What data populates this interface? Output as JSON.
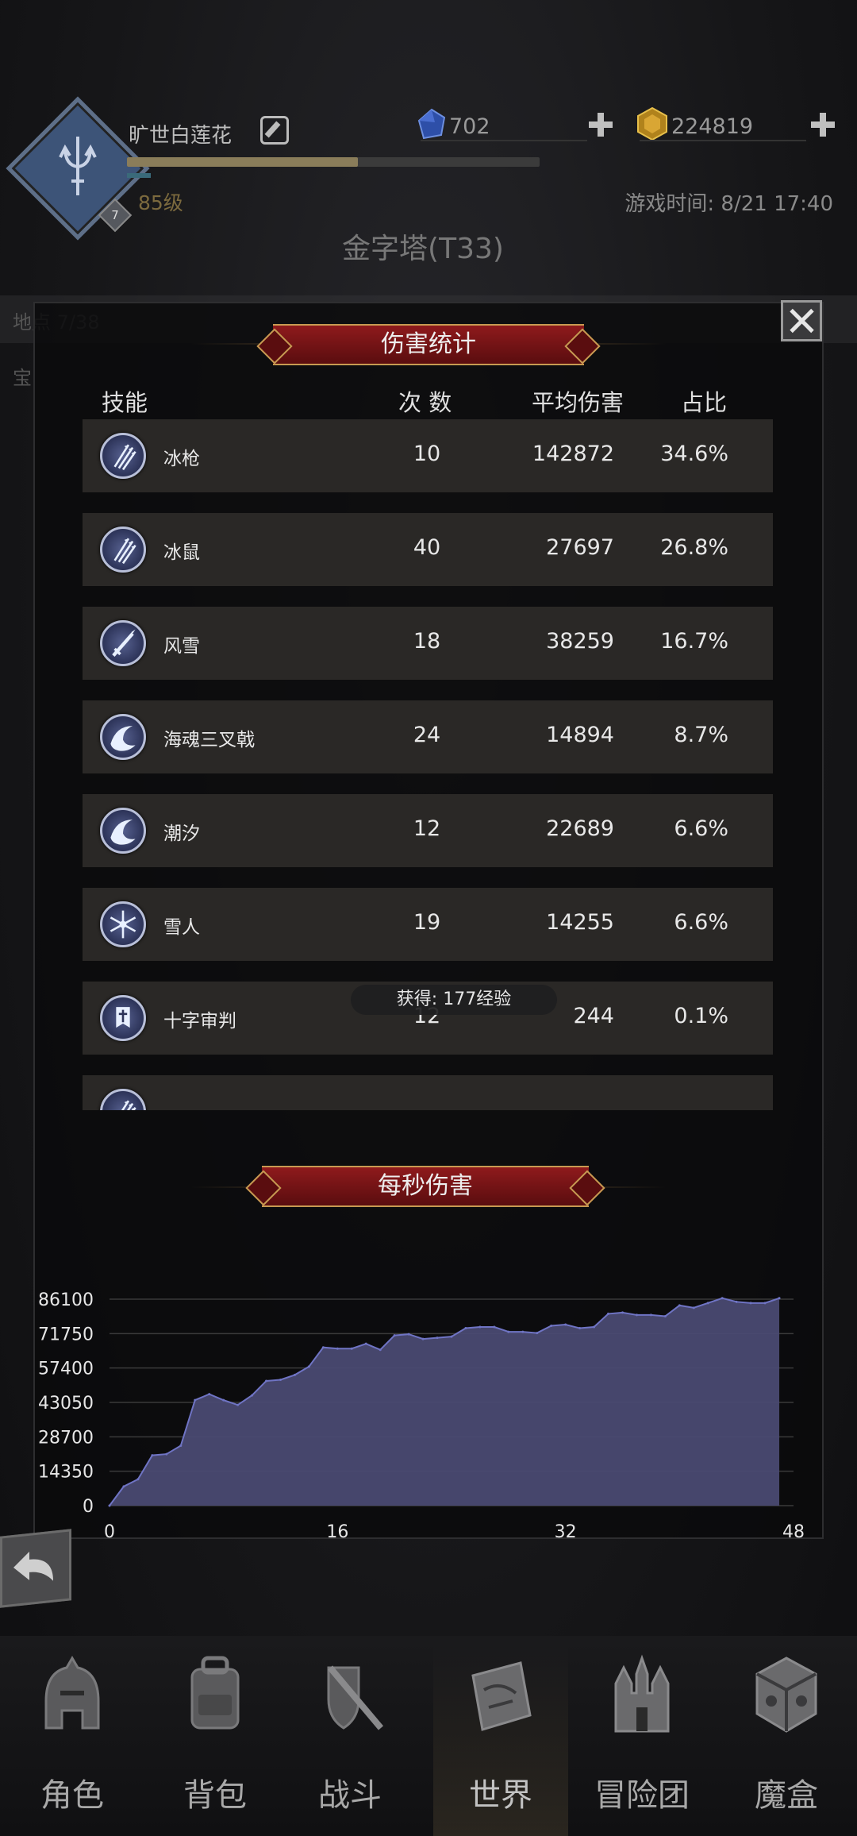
{
  "header": {
    "player_name": "旷世白莲花",
    "avatar_badge": "7",
    "level": "85级",
    "exp_progress": 0.56,
    "gems": "702",
    "gold": "224819",
    "game_time": "游戏时间: 8/21 17:40",
    "stage_title": "金字塔(T33)"
  },
  "background": {
    "location_label": "地点 7/38",
    "treasure_label": "宝"
  },
  "damage_stats": {
    "title": "伤害统计",
    "columns": {
      "skill": "技能",
      "count": "次 数",
      "avg": "平均伤害",
      "pct": "占比"
    },
    "rows": [
      {
        "name": "冰枪",
        "count": "10",
        "avg": "142872",
        "pct": "34.6%",
        "icon": "ice-spears-icon"
      },
      {
        "name": "冰鼠",
        "count": "40",
        "avg": "27697",
        "pct": "26.8%",
        "icon": "ice-spears-icon"
      },
      {
        "name": "风雪",
        "count": "18",
        "avg": "38259",
        "pct": "16.7%",
        "icon": "ice-sword-icon"
      },
      {
        "name": "海魂三叉戟",
        "count": "24",
        "avg": "14894",
        "pct": "8.7%",
        "icon": "wave-icon"
      },
      {
        "name": "潮汐",
        "count": "12",
        "avg": "22689",
        "pct": "6.6%",
        "icon": "wave-icon"
      },
      {
        "name": "雪人",
        "count": "19",
        "avg": "14255",
        "pct": "6.6%",
        "icon": "snowflake-icon"
      },
      {
        "name": "十字审判",
        "count": "12",
        "avg": "244",
        "pct": "0.1%",
        "icon": "cross-banner-icon"
      },
      {
        "name": "",
        "count": "",
        "avg": "",
        "pct": "",
        "icon": "ice-spears-icon"
      }
    ]
  },
  "toast": "获得: 177经验",
  "dps": {
    "title": "每秒伤害"
  },
  "chart_data": {
    "type": "area",
    "title": "每秒伤害",
    "xlabel": "",
    "ylabel": "",
    "xlim": [
      0,
      48
    ],
    "ylim": [
      0,
      86100
    ],
    "x_ticks": [
      0,
      16,
      32,
      48
    ],
    "y_ticks": [
      0,
      14350,
      28700,
      43050,
      57400,
      71750,
      86100
    ],
    "grid": true,
    "color": "#4a4a72",
    "line_color": "#6f74c4",
    "x": [
      0,
      1,
      2,
      3,
      4,
      5,
      6,
      7,
      8,
      9,
      10,
      11,
      12,
      13,
      14,
      15,
      16,
      17,
      18,
      19,
      20,
      21,
      22,
      23,
      24,
      25,
      26,
      27,
      28,
      29,
      30,
      31,
      32,
      33,
      34,
      35,
      36,
      37,
      38,
      39,
      40,
      41,
      42,
      43,
      44,
      45,
      46,
      47
    ],
    "values": [
      0,
      8000,
      11000,
      21000,
      21500,
      25000,
      44000,
      46500,
      44000,
      42000,
      46000,
      52000,
      52500,
      54500,
      58000,
      66000,
      65500,
      65500,
      67500,
      65000,
      71000,
      71500,
      69500,
      70000,
      70500,
      74000,
      74500,
      74500,
      72500,
      72500,
      72000,
      75000,
      75500,
      74000,
      74500,
      80000,
      80500,
      79500,
      79500,
      79000,
      83500,
      82500,
      84500,
      86500,
      85000,
      84500,
      84500,
      86500
    ]
  },
  "nav": {
    "items": [
      {
        "label": "角色",
        "icon": "helmet-icon"
      },
      {
        "label": "背包",
        "icon": "backpack-icon"
      },
      {
        "label": "战斗",
        "icon": "sword-shield-icon"
      },
      {
        "label": "世界",
        "icon": "map-scroll-icon"
      },
      {
        "label": "冒险团",
        "icon": "castle-icon"
      },
      {
        "label": "魔盒",
        "icon": "magic-cube-icon"
      }
    ],
    "active_index": 3
  }
}
